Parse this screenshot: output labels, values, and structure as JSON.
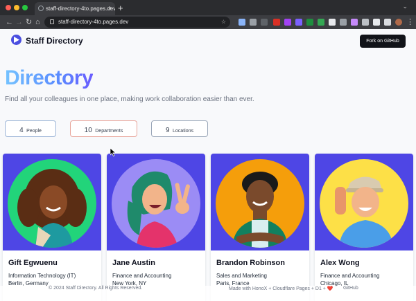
{
  "browser": {
    "tab_title": "staff-directory-4to.pages.dev",
    "tab_close": "×",
    "new_tab": "+",
    "url": "staff-directory-4to.pages.dev",
    "back": "←",
    "forward": "→",
    "reload": "↻",
    "home": "⌂"
  },
  "header": {
    "brand": "Staff Directory",
    "fork_label": "Fork on GitHub"
  },
  "hero": {
    "title": "Directory",
    "subtitle": "Find all your colleagues in one place, making work collaboration easier than ever."
  },
  "stats": [
    {
      "count": "4",
      "label": "People",
      "border": "#9bb4d6"
    },
    {
      "count": "10",
      "label": "Departments",
      "border": "#e8a49a"
    },
    {
      "count": "9",
      "label": "Locations",
      "border": "#9aa6b8"
    }
  ],
  "people": [
    {
      "name": "Gift Egwuenu",
      "department": "Information Technology (IT)",
      "location": "Berlin, Germany",
      "avatar_bg": "#22d47a",
      "avatar_icon": "person-curly-hair-icon"
    },
    {
      "name": "Jane Austin",
      "department": "Finance and Accounting",
      "location": "New York, NY",
      "avatar_bg": "#9b8cf5",
      "avatar_icon": "person-peace-sign-icon"
    },
    {
      "name": "Brandon Robinson",
      "department": "Sales and Marketing",
      "location": "Paris, France",
      "avatar_bg": "#f59e0b",
      "avatar_icon": "person-arms-crossed-icon"
    },
    {
      "name": "Alex Wong",
      "department": "Finance and Accounting",
      "location": "Chicago, IL",
      "avatar_bg": "#fde047",
      "avatar_icon": "person-waving-icon"
    }
  ],
  "footer": {
    "copyright": "© 2024 Staff Directory. All Rights Reserved.",
    "made_with": "Made with HonoX + Cloudflare Pages + D1 + ❤️",
    "github": "GitHub"
  },
  "colors": {
    "accent": "#4e46e5",
    "title_gradient_start": "#74c3ff",
    "title_gradient_end": "#6a5cff"
  }
}
